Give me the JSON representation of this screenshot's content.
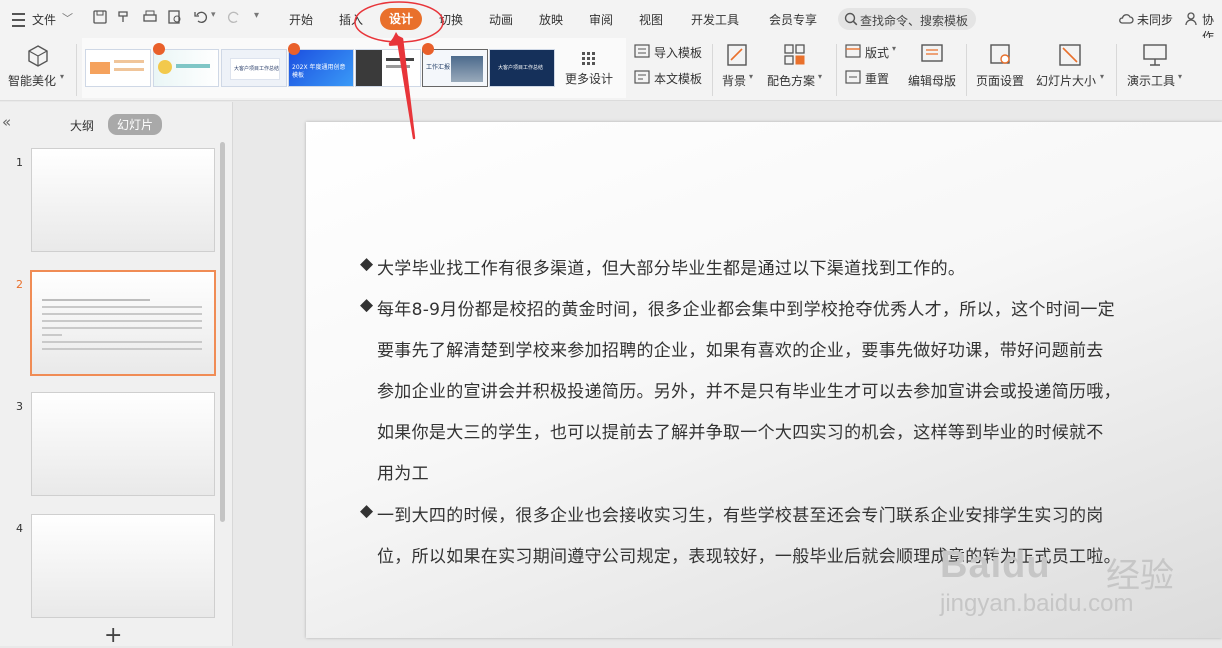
{
  "topbar": {
    "file_menu": "文件",
    "tabs": [
      "开始",
      "插入",
      "设计",
      "切换",
      "动画",
      "放映",
      "审阅",
      "视图",
      "开发工具",
      "会员专享"
    ],
    "search_placeholder": "查找命令、搜索模板",
    "sync_status": "未同步",
    "collab": "协作"
  },
  "ribbon": {
    "smart_beautify": "智能美化",
    "template_thumbs": [
      {
        "text": ""
      },
      {
        "text": ""
      },
      {
        "text": "大客户项目工作总结"
      },
      {
        "text": "202X 年度通用创意模板"
      },
      {
        "text": ""
      },
      {
        "text": "工作汇报"
      },
      {
        "text": "大客户项目工作总结"
      }
    ],
    "more_designs": "更多设计",
    "import_template": "导入模板",
    "this_template": "本文模板",
    "background": "背景",
    "color_scheme": "配色方案",
    "layout": "版式",
    "reset": "重置",
    "edit_master": "编辑母版",
    "page_setup": "页面设置",
    "slide_size": "幻灯片大小",
    "present_tools": "演示工具"
  },
  "left_panel": {
    "outline_tab": "大纲",
    "slides_tab": "幻灯片",
    "slides": [
      {
        "num": "1"
      },
      {
        "num": "2"
      },
      {
        "num": "3"
      },
      {
        "num": "4"
      }
    ],
    "add_slide": "+"
  },
  "slide": {
    "bullet": "◆",
    "p1": "大学毕业找工作有很多渠道，但大部分毕业生都是通过以下渠道找到工作的。",
    "p2_lines": [
      "每年8-9月份都是校招的黄金时间，很多企业都会集中到学校抢夺优秀人才，所以，这个时间一定",
      "要事先了解清楚到学校来参加招聘的企业，如果有喜欢的企业，要事先做好功课，带好问题前去",
      "参加企业的宣讲会并积极投递简历。另外，并不是只有毕业生才可以去参加宣讲会或投递简历哦，",
      "如果你是大三的学生，也可以提前去了解并争取一个大四实习的机会，这样等到毕业的时候就不",
      "用为工"
    ],
    "p3_lines": [
      "一到大四的时候，很多企业也会接收实习生，有些学校甚至还会专门联系企业安排学生实习的岗",
      "位，所以如果在实习期间遵守公司规定，表现较好，一般毕业后就会顺理成章的转为正式员工啦。"
    ]
  },
  "watermark": {
    "brand": "Baidu",
    "cn": "经验",
    "url": "jingyan.baidu.com"
  },
  "colors": {
    "accent": "#e9702b",
    "annotation": "#e8353a"
  }
}
